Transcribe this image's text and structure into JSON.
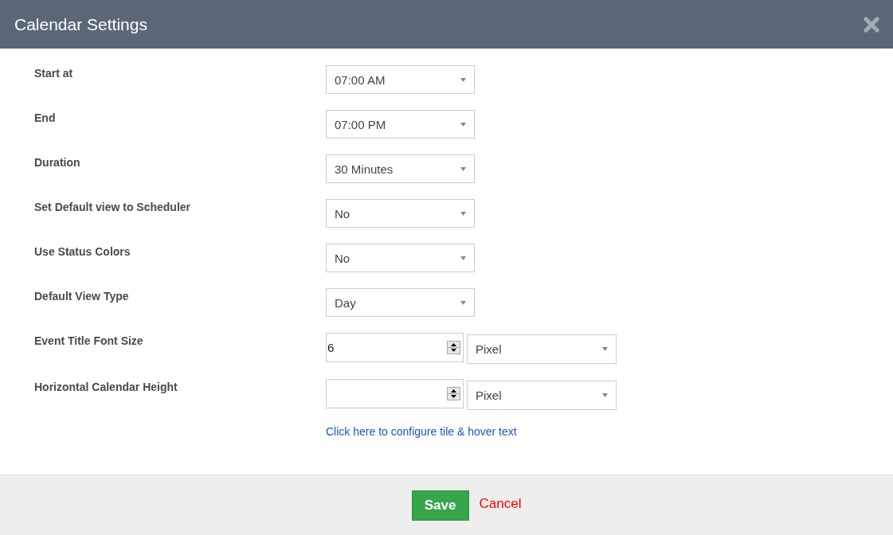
{
  "window": {
    "title": "Calendar Settings"
  },
  "fields": [
    {
      "kind": "select",
      "label": "Start at",
      "value": "07:00 AM"
    },
    {
      "kind": "select",
      "label": "End",
      "value": "07:00 PM"
    },
    {
      "kind": "select",
      "label": "Duration",
      "value": "30 Minutes"
    },
    {
      "kind": "select",
      "label": "Set Default view to Scheduler",
      "value": "No"
    },
    {
      "kind": "select",
      "label": "Use Status Colors",
      "value": "No"
    },
    {
      "kind": "select",
      "label": "Default View Type",
      "value": "Day"
    },
    {
      "kind": "number_unit",
      "label": "Event Title Font Size",
      "value": "6",
      "unit": "Pixel"
    },
    {
      "kind": "number_unit",
      "label": "Horizontal Calendar Height",
      "unit": "Pixel"
    }
  ],
  "link": "Click here to configure tile & hover text",
  "buttons": {
    "save": "Save",
    "cancel": "Cancel"
  }
}
